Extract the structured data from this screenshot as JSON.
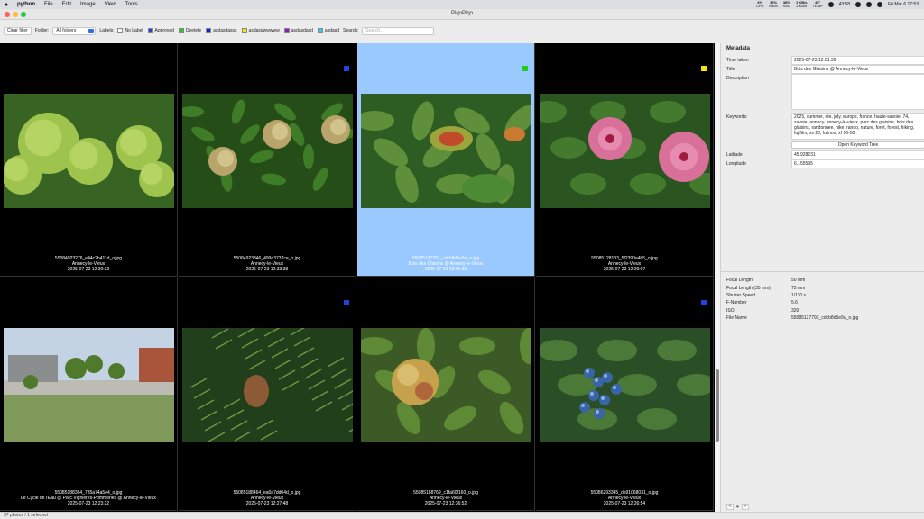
{
  "menubar": {
    "apple": "",
    "items": [
      "python",
      "File",
      "Edit",
      "Image",
      "View",
      "Tools"
    ],
    "stats": [
      {
        "top": "4%",
        "bottom": "CPU"
      },
      {
        "top": "36%",
        "bottom": "MEM"
      },
      {
        "top": "38%",
        "bottom": "SSD"
      },
      {
        "top": "1 KB/s",
        "bottom": "2 KB/s"
      },
      {
        "top": "45°",
        "bottom": "TEMP"
      }
    ],
    "battery": "43:58",
    "clock": "Fri Mar 6  17:53"
  },
  "window": {
    "title": "PiqoPiqo"
  },
  "toolbar": {
    "clear_filter": "Clear filter",
    "folder_label": "Folder:",
    "folder_value": "All folders",
    "labels_label": "Labels:",
    "labels": [
      {
        "name": "No Label",
        "color": "#ffffff"
      },
      {
        "name": "Approved",
        "color": "#2340e0"
      },
      {
        "name": "Deelete",
        "color": "#22cc22"
      },
      {
        "name": "asdasdasss",
        "color": "#1122dd"
      },
      {
        "name": "asdasdwwwww",
        "color": "#f4e800"
      },
      {
        "name": "asdasdasd",
        "color": "#8a1ec4"
      },
      {
        "name": "asdasd",
        "color": "#3cc8ea"
      }
    ],
    "search_label": "Search:",
    "search_placeholder": "Search..."
  },
  "photos": [
    {
      "file": "55084923276_e44c2b411d_o.jpg",
      "line2": "Annecy-le-Vieux",
      "date": "2025-07-23 12:30:33",
      "marker": null,
      "selected": false,
      "scene": "hydrangea"
    },
    {
      "file": "55084923346_499d3737ce_o.jpg",
      "line2": "Annecy-le-Vieux",
      "date": "2025-07-23 12:33:38",
      "marker": "#2340e0",
      "selected": false,
      "scene": "buds"
    },
    {
      "file": "55085127793_cdcb8d5e9a_o.jpg",
      "line2": "Bois des Glaisins @ Annecy-le-Vieux",
      "date": "2025-07-23 12:01:39",
      "marker": "#22cc22",
      "selected": true,
      "scene": "leaves"
    },
    {
      "file": "55085128133_5f2390e4b5_o.jpg",
      "line2": "Annecy-le-Vieux",
      "date": "2025-07-23 12:29:07",
      "marker": "#f4e800",
      "selected": false,
      "scene": "hibiscus"
    },
    {
      "file": "55085188364_735a74a5e4_o.jpg",
      "line2": "Le Cycle de l'Eau @ Parc Vignières-Pommeries @ Annecy-le-Vieux",
      "date": "2025-07-23 12:23:22",
      "marker": null,
      "selected": false,
      "scene": "park"
    },
    {
      "file": "55085188464_ea0a7dd04d_o.jpg",
      "line2": "Annecy-le-Vieux",
      "date": "2025-07-23 12:27:48",
      "marker": "#2340e0",
      "selected": false,
      "scene": "pine"
    },
    {
      "file": "55085188769_c1fa60f160_o.jpg",
      "line2": "Annecy-le-Vieux",
      "date": "2025-07-23 12:36:52",
      "marker": null,
      "selected": false,
      "scene": "apple"
    },
    {
      "file": "55086293345_db91068031_o.jpg",
      "line2": "Annecy-le-Vieux",
      "date": "2025-07-23 12:26:54",
      "marker": "#2340e0",
      "selected": false,
      "scene": "berries"
    }
  ],
  "metadata": {
    "heading": "Metadata",
    "fields": [
      {
        "label": "Time taken",
        "value": "2025-07-23 12:01:39"
      },
      {
        "label": "Title",
        "value": "Bois des Glaisins @ Annecy-le-Vieux"
      },
      {
        "label": "Description",
        "value": ""
      },
      {
        "label": "Keywords:",
        "value": "2025, summer, ete, july, europe, france, haute-savoie, 74, savoie, annecy, annecy-le-vieux, parc des glaisins, bois des glaisins, randonnee, hike, rando, nature, foret, forest, hiking, fujifilm, xs 20, fujinon, xf 16-50"
      },
      {
        "label": "Latitude",
        "value": "45.928231"
      },
      {
        "label": "Longitude",
        "value": "6.155595"
      }
    ],
    "keyword_tree_button": "Open Keyword Tree",
    "exif": [
      {
        "label": "Focal Length",
        "value": "50 mm"
      },
      {
        "label": "Focal Length (35 mm)",
        "value": "75 mm"
      },
      {
        "label": "Shutter Speed",
        "value": "1/110 s"
      },
      {
        "label": "F-Number",
        "value": "5.6"
      },
      {
        "label": "ISO",
        "value": "320"
      },
      {
        "label": "File Name",
        "value": "55085127793_cdcb8d5e9a_o.jpg"
      }
    ],
    "pager": {
      "prev": "<",
      "page": "4",
      "next": ">"
    }
  },
  "status": "37 photos / 1 selected"
}
